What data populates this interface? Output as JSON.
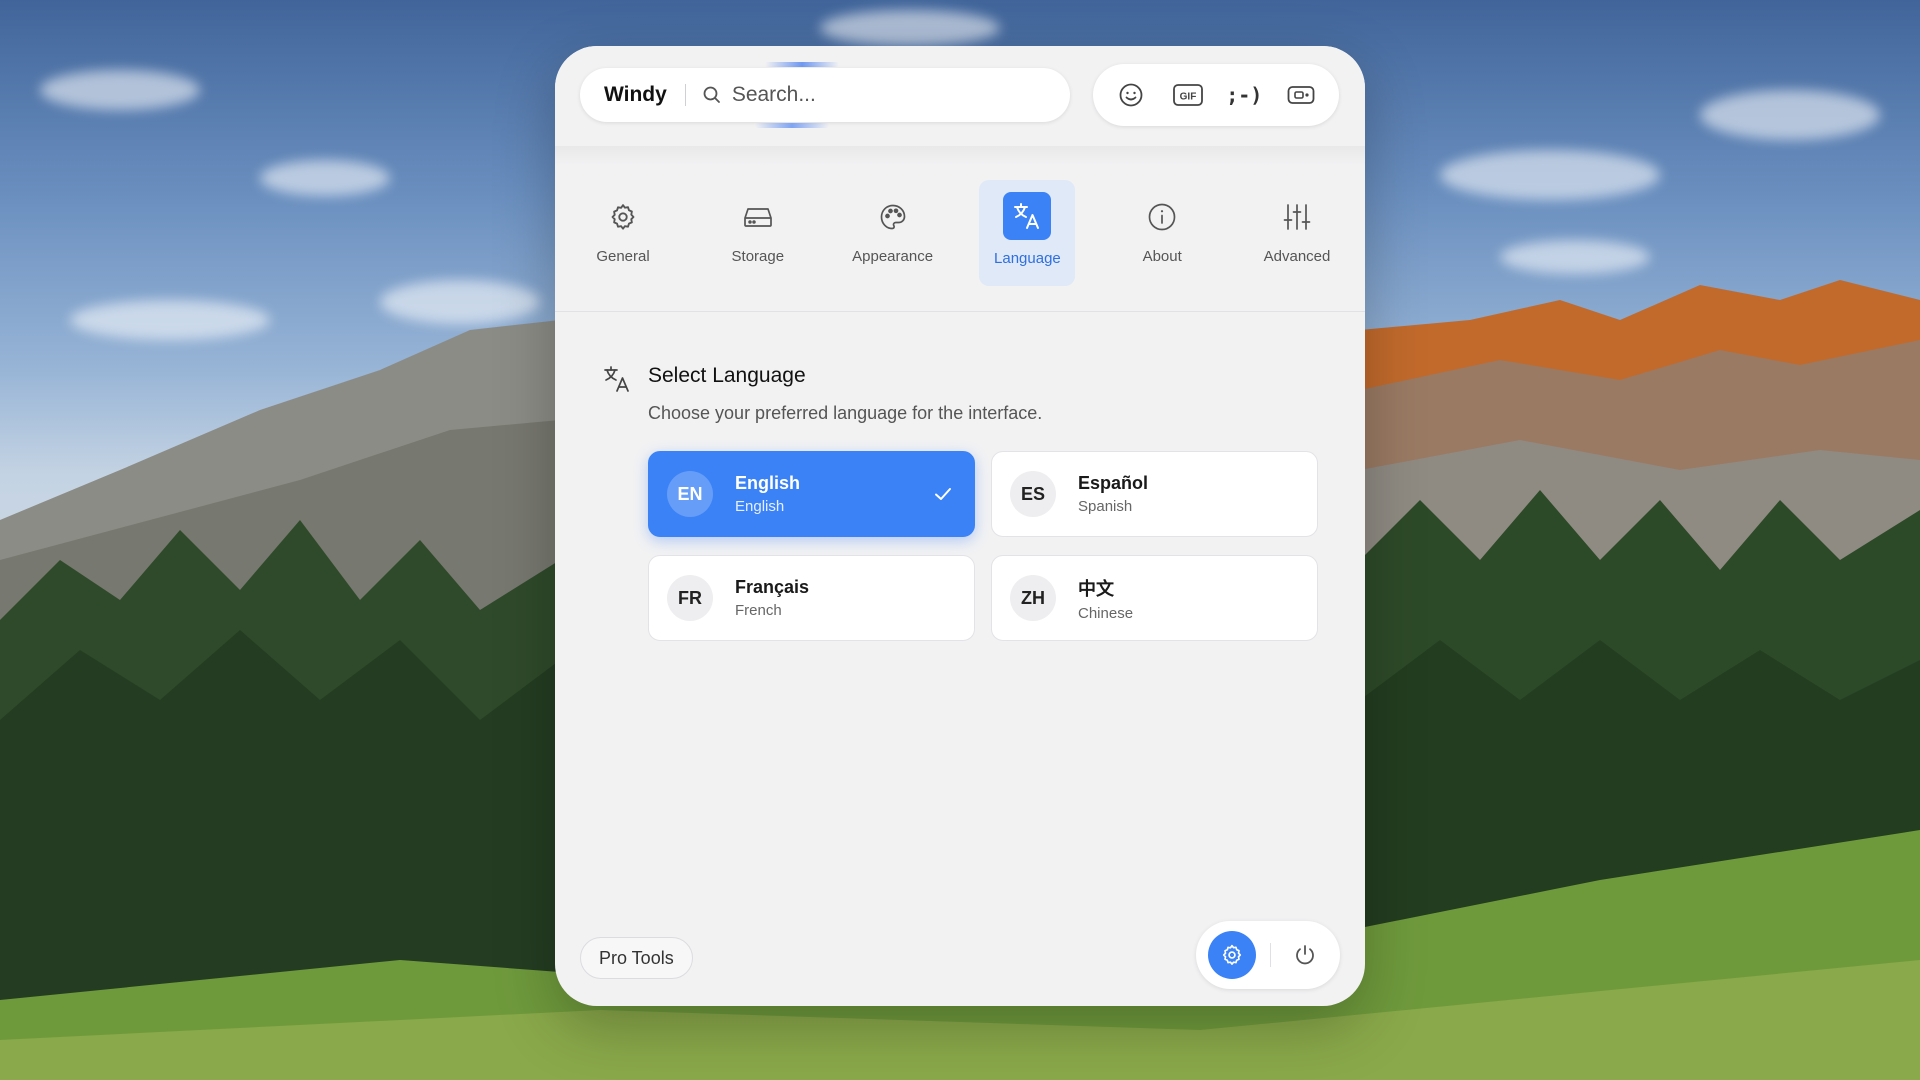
{
  "app": {
    "name": "Windy"
  },
  "search": {
    "placeholder": "Search..."
  },
  "toolbar": {
    "items": [
      {
        "icon": "emoji-icon"
      },
      {
        "icon": "gif-icon",
        "label": "GIF"
      },
      {
        "icon": "kaomoji-icon",
        "label": ";-)"
      },
      {
        "icon": "clipboard-icon"
      }
    ]
  },
  "nav": {
    "active": "Language",
    "items": [
      {
        "label": "General",
        "icon": "gear-icon"
      },
      {
        "label": "Storage",
        "icon": "drive-icon"
      },
      {
        "label": "Appearance",
        "icon": "palette-icon"
      },
      {
        "label": "Language",
        "icon": "translate-icon"
      },
      {
        "label": "About",
        "icon": "info-icon"
      },
      {
        "label": "Advanced",
        "icon": "sliders-icon"
      }
    ]
  },
  "section": {
    "title": "Select Language",
    "description": "Choose your preferred language for the interface.",
    "icon": "translate-icon"
  },
  "languages": [
    {
      "code": "EN",
      "native": "English",
      "english": "English",
      "selected": true
    },
    {
      "code": "ES",
      "native": "Español",
      "english": "Spanish",
      "selected": false
    },
    {
      "code": "FR",
      "native": "Français",
      "english": "French",
      "selected": false
    },
    {
      "code": "ZH",
      "native": "中文",
      "english": "Chinese",
      "selected": false
    }
  ],
  "footer": {
    "pro_tools_label": "Pro Tools",
    "settings_icon": "gear-icon",
    "power_icon": "power-icon"
  },
  "colors": {
    "accent": "#3b82f6",
    "active_tab_bg": "#dfe9f8",
    "window_bg": "#f2f2f3"
  }
}
